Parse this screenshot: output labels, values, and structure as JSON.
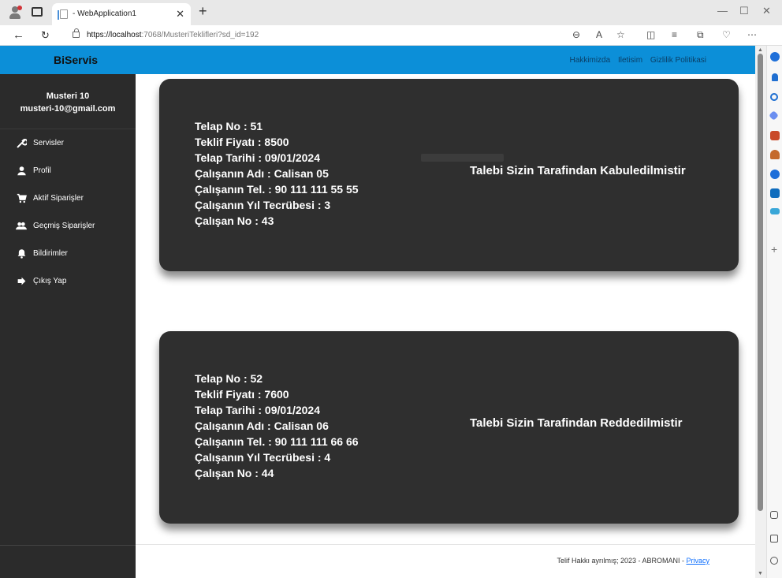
{
  "browser": {
    "tab_title": "- WebApplication1",
    "url_host": "https://localhost",
    "url_path": ":7068/MusteriTeklifleri?sd_id=192",
    "window_minimize": "—",
    "window_maximize": "☐",
    "window_close": "✕"
  },
  "header": {
    "brand": "BiServis",
    "links": [
      "Hakkimizda",
      "Iletisim",
      "Gizlilik Politikasi"
    ]
  },
  "user": {
    "name": "Musteri 10",
    "email": "musteri-10@gmail.com"
  },
  "sidebar": {
    "items": [
      {
        "label": "Servisler",
        "icon": "wrench-icon"
      },
      {
        "label": "Profil",
        "icon": "user-icon"
      },
      {
        "label": "Aktif Siparişler",
        "icon": "cart-icon"
      },
      {
        "label": "Geçmiş Siparişler",
        "icon": "users-icon"
      },
      {
        "label": "Bildirimler",
        "icon": "bell-icon"
      },
      {
        "label": "Çıkış Yap",
        "icon": "logout-icon"
      }
    ]
  },
  "offers": [
    {
      "talep_no": "Telap No : 51",
      "fiyat": "Teklif Fiyatı : 8500",
      "tarih": "Telap Tarihi : 09/01/2024",
      "calisan_adi": "Çalışanın Adı : Calisan 05",
      "calisan_tel": "Çalışanın Tel. : 90 111 111 55 55",
      "tecrube": "Çalışanın Yıl Tecrübesi : 3",
      "calisan_no": "Çalışan No : 43",
      "status": "Talebi Sizin Tarafindan Kabuledilmistir"
    },
    {
      "talep_no": "Telap No : 52",
      "fiyat": "Teklif Fiyatı : 7600",
      "tarih": "Telap Tarihi : 09/01/2024",
      "calisan_adi": "Çalışanın Adı : Calisan 06",
      "calisan_tel": "Çalışanın Tel. : 90 111 111 66 66",
      "tecrube": "Çalışanın Yıl Tecrübesi : 4",
      "calisan_no": "Çalışan No : 44",
      "status": "Talebi Sizin Tarafindan Reddedilmistir"
    }
  ],
  "footer": {
    "text": "Telif Hakkı ayrılmış; 2023 - ABROMANI - ",
    "privacy": "Privacy"
  },
  "colors": {
    "navbar": "#0c8fd8",
    "sidebar": "#2b2b2b",
    "card": "#2f2f2f"
  }
}
